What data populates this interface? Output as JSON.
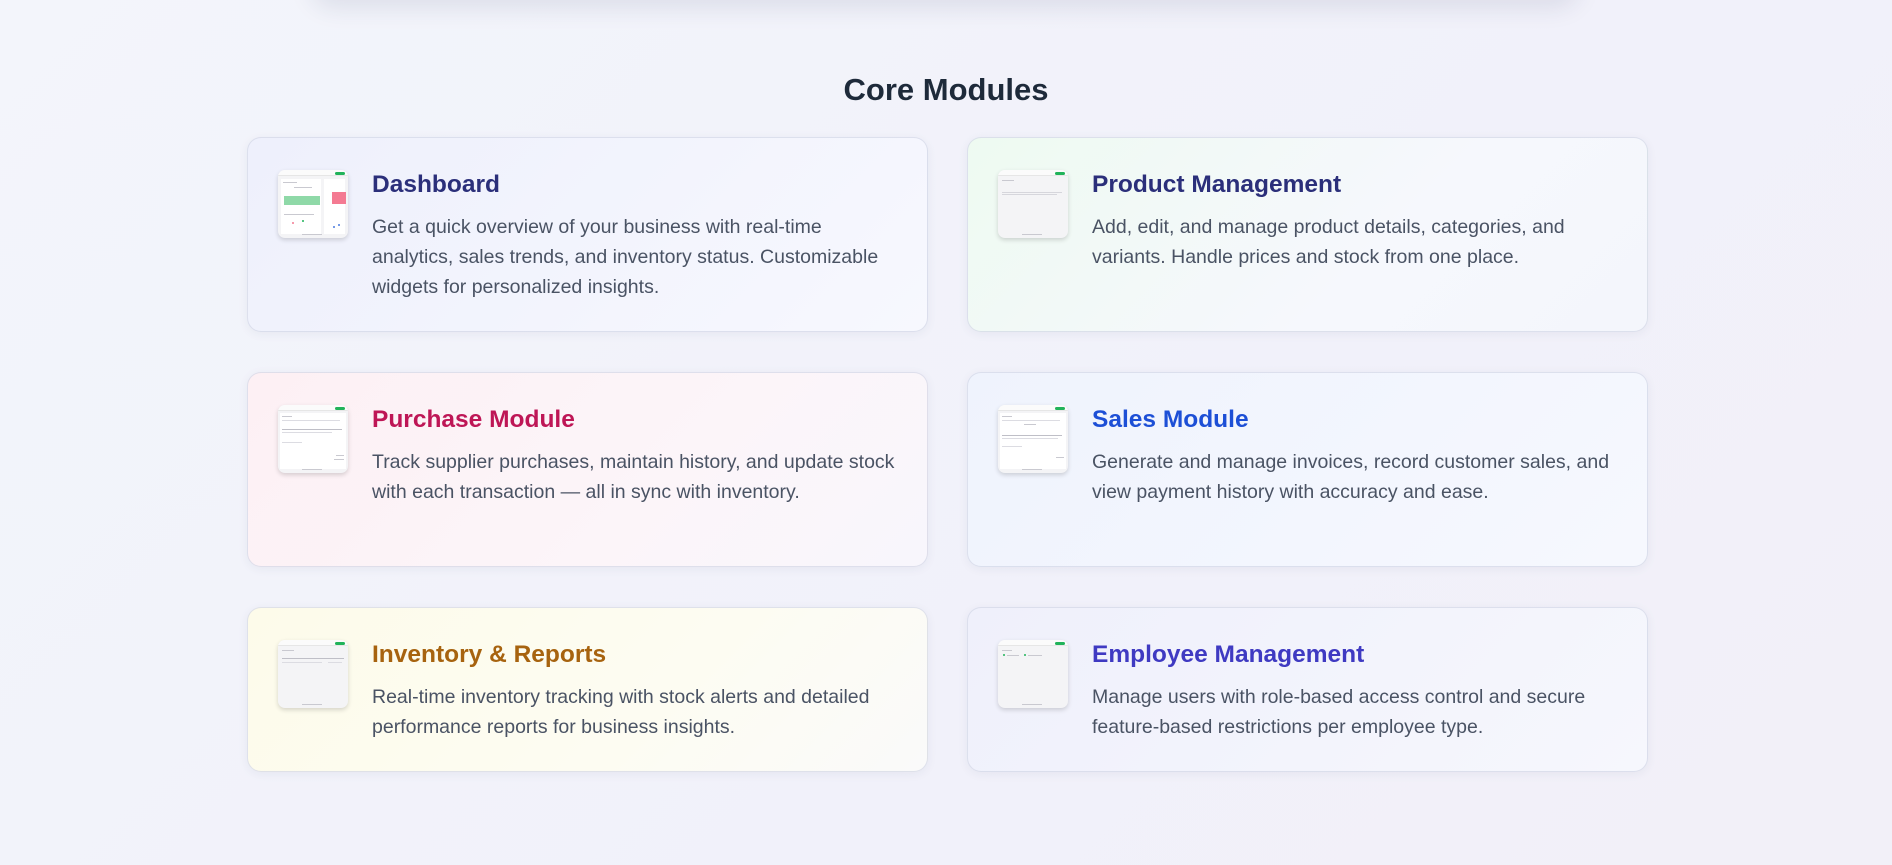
{
  "section": {
    "title": "Core Modules"
  },
  "modules": [
    {
      "title": "Dashboard",
      "description": "Get a quick overview of your business with real-time analytics, sales trends, and inventory status. Customizable widgets for personalized insights.",
      "accent": "#2b2f7a"
    },
    {
      "title": "Product Management",
      "description": "Add, edit, and manage product details, categories, and variants. Handle prices and stock from one place.",
      "accent": "#2b2f7a"
    },
    {
      "title": "Purchase Module",
      "description": "Track supplier purchases, maintain history, and update stock with each transaction — all in sync with inventory.",
      "accent": "#be1656"
    },
    {
      "title": "Sales Module",
      "description": "Generate and manage invoices, record customer sales, and view payment history with accuracy and ease.",
      "accent": "#1d4fd6"
    },
    {
      "title": "Inventory & Reports",
      "description": "Real-time inventory tracking with stock alerts and detailed performance reports for business insights.",
      "accent": "#a7630f"
    },
    {
      "title": "Employee Management",
      "description": "Manage users with role-based access control and secure feature-based restrictions per employee type.",
      "accent": "#3f3ac2"
    }
  ]
}
